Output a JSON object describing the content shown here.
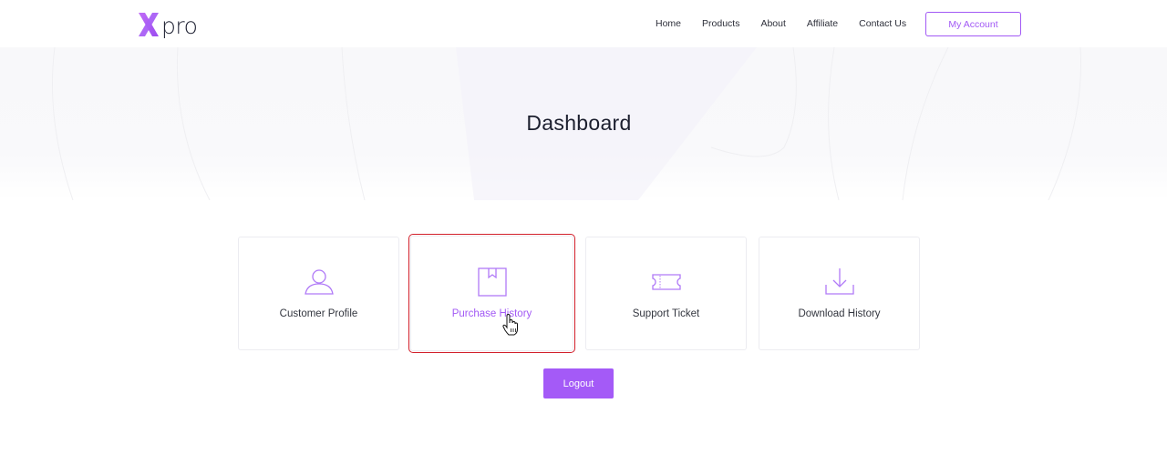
{
  "header": {
    "logo_text": "pro",
    "nav": [
      {
        "label": "Home"
      },
      {
        "label": "Products"
      },
      {
        "label": "About"
      },
      {
        "label": "Affiliate"
      },
      {
        "label": "Contact Us"
      }
    ],
    "account_button": "My Account"
  },
  "hero": {
    "title": "Dashboard"
  },
  "cards": [
    {
      "label": "Customer Profile",
      "icon": "user-icon"
    },
    {
      "label": "Purchase History",
      "icon": "box-icon",
      "state": "hovered"
    },
    {
      "label": "Support Ticket",
      "icon": "ticket-icon"
    },
    {
      "label": "Download History",
      "icon": "download-icon"
    }
  ],
  "logout_label": "Logout",
  "colors": {
    "accent": "#a259f5",
    "highlight_outline": "#d21f2a",
    "text": "#33363f"
  }
}
